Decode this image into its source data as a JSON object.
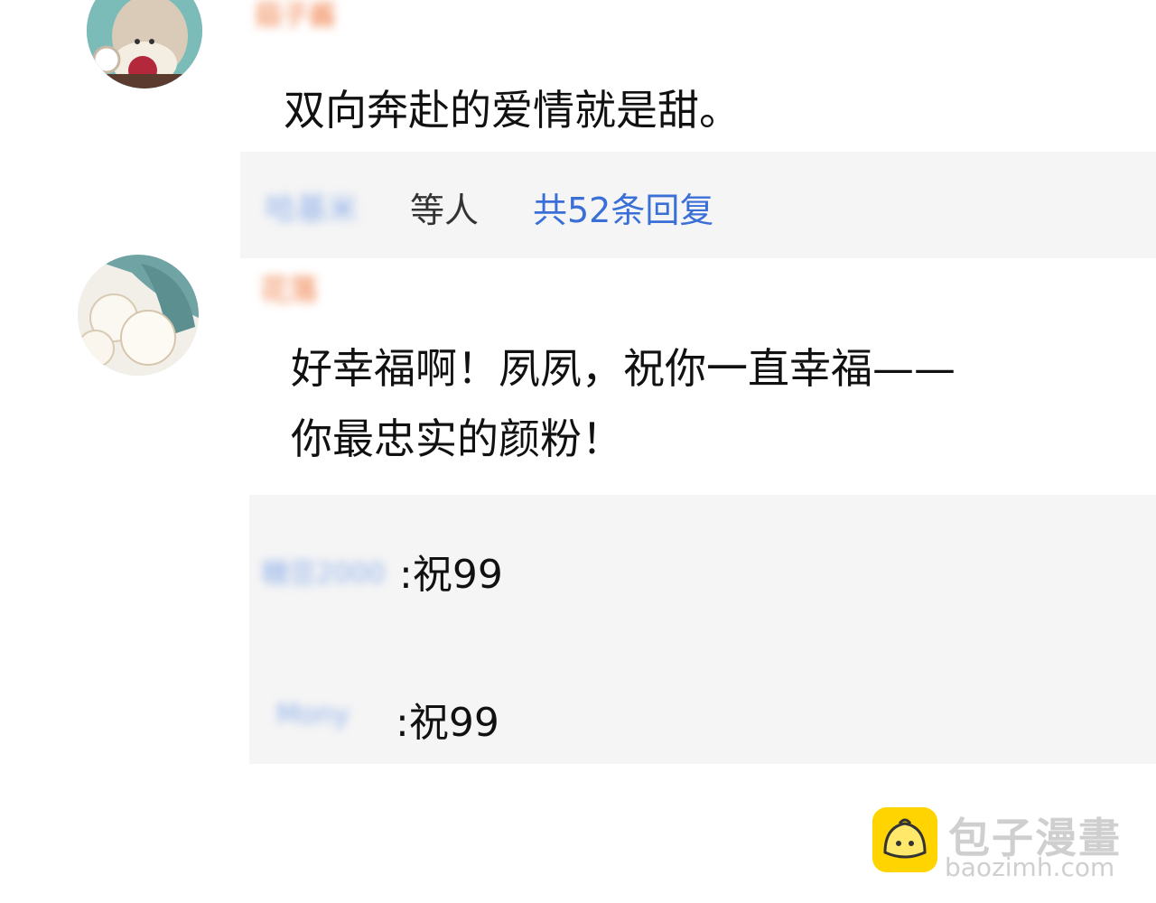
{
  "comments": [
    {
      "username": "菇子酱",
      "text": "双向奔赴的爱情就是甜。",
      "reply_preview": {
        "replier": "哈基米",
        "suffix": "等人",
        "link": "共52条回复"
      }
    },
    {
      "username": "花落",
      "text_lines": [
        "好幸福啊！夙夙，祝你一直幸福——",
        "你最忠实的颜粉！"
      ],
      "replies": [
        {
          "user": "糖豆2000",
          "text": ":祝99"
        },
        {
          "user": "Mony",
          "text": ":祝99"
        }
      ]
    }
  ],
  "watermark": {
    "cn": "包子漫畫",
    "en": "baozimh.com"
  },
  "colors": {
    "link": "#3a6fd8",
    "reply_bg": "#f5f5f5",
    "username_blur": "#f4a27a",
    "watermark_yellow": "#ffd400"
  }
}
